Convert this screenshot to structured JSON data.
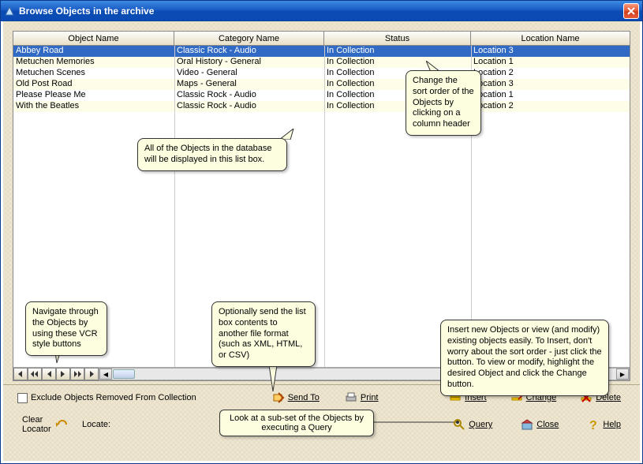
{
  "window": {
    "title": "Browse Objects in the archive"
  },
  "columns": [
    "Object Name",
    "Category Name",
    "Status",
    "Location Name"
  ],
  "rows": [
    {
      "object": "Abbey Road",
      "category": "Classic Rock - Audio",
      "status": "In Collection",
      "location": "Location 3",
      "selected": true
    },
    {
      "object": "Metuchen Memories",
      "category": "Oral History - General",
      "status": "In Collection",
      "location": "Location 1"
    },
    {
      "object": "Metuchen Scenes",
      "category": "Video - General",
      "status": "In Collection",
      "location": "Location 2"
    },
    {
      "object": "Old Post Road",
      "category": "Maps - General",
      "status": "In Collection",
      "location": "Location 3"
    },
    {
      "object": "Please Please Me",
      "category": "Classic Rock - Audio",
      "status": "In Collection",
      "location": "Location 1"
    },
    {
      "object": "With the Beatles",
      "category": "Classic Rock - Audio",
      "status": "In Collection",
      "location": "Location 2"
    }
  ],
  "callouts": {
    "sort": "Change the sort order of the Objects by clicking on a column header",
    "listbox": "All of the Objects in the database will be displayed in this list box.",
    "navigate": "Navigate through the Objects by using these VCR style buttons",
    "sendto": "Optionally send the list box contents to another file format (such as XML, HTML, or CSV)",
    "insert": "Insert new Objects or view (and modify) existing objects easily. To Insert, don't worry about the sort order - just click the button. To view or modify, highlight the desired Object and click the Change button.",
    "query": "Look at a sub-set of the Objects by executing a Query"
  },
  "bottom": {
    "exclude": "Exclude Objects Removed From Collection",
    "sendto": "Send To",
    "print": "Print",
    "insert": "Insert",
    "change": "Change",
    "delete": "Delete",
    "clear": "Clear Locator",
    "locate": "Locate:",
    "query": "Query",
    "close": "Close",
    "help": "Help"
  },
  "nav": {
    "first": "|◀◀",
    "prevpage": "◀◀",
    "prev": "◀",
    "next": "▶",
    "nextpage": "▶▶",
    "last": "▶▶|"
  }
}
